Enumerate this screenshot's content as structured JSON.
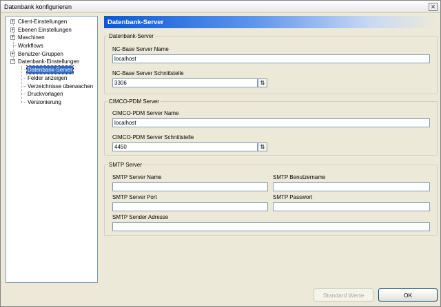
{
  "window": {
    "title": "Datenbank konfigurieren",
    "close_glyph": "✕"
  },
  "tree": {
    "items": [
      {
        "label": "Client-Einstellungen",
        "expander": "+",
        "level": 0
      },
      {
        "label": "Ebenen Einstellungen",
        "expander": "+",
        "level": 0
      },
      {
        "label": "Maschinen",
        "expander": "+",
        "level": 0
      },
      {
        "label": "Workflows",
        "expander": "",
        "level": 0
      },
      {
        "label": "Benutzer-Gruppen",
        "expander": "+",
        "level": 0
      },
      {
        "label": "Datenbank-Einstellungen",
        "expander": "−",
        "level": 0
      },
      {
        "label": "Datenbank-Server",
        "expander": "",
        "level": 1,
        "selected": true
      },
      {
        "label": "Felder anzeigen",
        "expander": "",
        "level": 1
      },
      {
        "label": "Verzeichnisse überwachen",
        "expander": "",
        "level": 1
      },
      {
        "label": "Druckvorlagen",
        "expander": "",
        "level": 1
      },
      {
        "label": "Versionierung",
        "expander": "",
        "level": 1
      }
    ]
  },
  "header": {
    "title": "Datenbank-Server"
  },
  "groups": {
    "nc": {
      "title": "Datenbank-Server",
      "name_label": "NC-Base Server Name",
      "name_value": "localhost",
      "port_label": "NC-Base Server Schnittstelle",
      "port_value": "3306"
    },
    "cimco": {
      "title": "CIMCO-PDM Server",
      "name_label": "CIMCO-PDM Server Name",
      "name_value": "localhost",
      "port_label": "CIMCO-PDM Server Schnittstelle",
      "port_value": "4450"
    },
    "smtp": {
      "title": "SMTP Server",
      "server_name_label": "SMTP Server Name",
      "server_name_value": "",
      "user_label": "SMTP Benutzername",
      "user_value": "",
      "port_label": "SMTP Server Port",
      "port_value": "",
      "password_label": "SMTP Passwort",
      "password_value": "",
      "sender_label": "SMTP Sender Adresse",
      "sender_value": ""
    }
  },
  "buttons": {
    "defaults_label": "Standard Werte",
    "ok_label": "OK"
  },
  "icons": {
    "spin_glyph": "⇅"
  }
}
